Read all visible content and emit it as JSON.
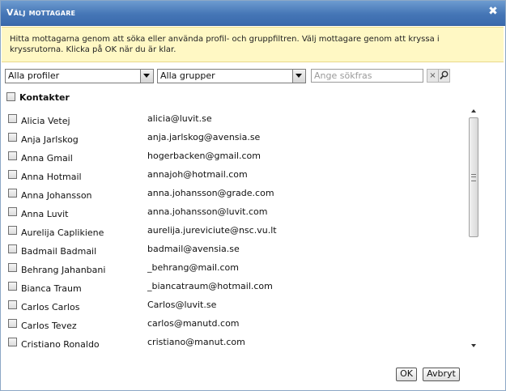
{
  "dialog": {
    "title": "Välj mottagare",
    "close_glyph": "✖"
  },
  "info": {
    "text": "Hitta mottagarna genom att söka eller använda profil- och gruppfiltren. Välj mottagare genom att kryssa i kryssrutorna. Klicka på OK när du är klar."
  },
  "filters": {
    "profile_selected": "Alla profiler",
    "group_selected": "Alla grupper",
    "search_placeholder": "Ange sökfras",
    "search_value": "",
    "clear_glyph": "×"
  },
  "contacts": {
    "group_label": "Kontakter",
    "items": [
      {
        "name": "Alicia Vetej",
        "email": "alicia@luvit.se"
      },
      {
        "name": "Anja Jarlskog",
        "email": "anja.jarlskog@avensia.se"
      },
      {
        "name": "Anna Gmail",
        "email": "hogerbacken@gmail.com"
      },
      {
        "name": "Anna Hotmail",
        "email": "annajoh@hotmail.com"
      },
      {
        "name": "Anna Johansson",
        "email": "anna.johansson@grade.com"
      },
      {
        "name": "Anna Luvit",
        "email": "anna.johansson@luvit.com"
      },
      {
        "name": "Aurelija Caplikiene",
        "email": "aurelija.jureviciute@nsc.vu.lt"
      },
      {
        "name": "Badmail Badmail",
        "email": "badmail@avensia.se"
      },
      {
        "name": "Behrang Jahanbani",
        "email": "_behrang@mail.com"
      },
      {
        "name": "Bianca Traum",
        "email": "_biancatraum@hotmail.com"
      },
      {
        "name": "Carlos Carlos",
        "email": "Carlos@luvit.se"
      },
      {
        "name": "Carlos Tevez",
        "email": "carlos@manutd.com"
      },
      {
        "name": "Cristiano Ronaldo",
        "email": "cristiano@manut.com"
      }
    ]
  },
  "buttons": {
    "ok_label": "OK",
    "cancel_label": "Avbryt"
  },
  "icons": {
    "close": "close-icon",
    "dropdown": "chevron-down-icon",
    "clear": "clear-icon",
    "search": "search-icon"
  },
  "colors": {
    "titlebar": "#4576b6",
    "info_bg": "#fff8c4"
  }
}
